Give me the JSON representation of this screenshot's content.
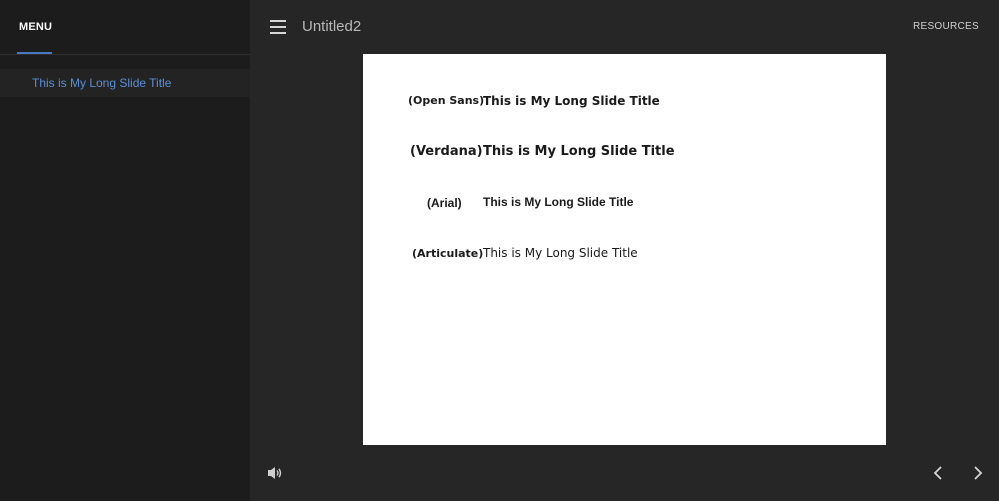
{
  "sidebar": {
    "tab_label": "MENU",
    "items": [
      {
        "label": "This is My Long Slide Title"
      }
    ]
  },
  "header": {
    "title": "Untitled2",
    "resources_label": "RESOURCES"
  },
  "slide": {
    "rows": [
      {
        "font_label": "(Open Sans)",
        "sample": "This is My Long Slide Title"
      },
      {
        "font_label": "(Verdana)",
        "sample": "This is My Long Slide Title"
      },
      {
        "font_label": "(Arial)",
        "sample": "This is My Long Slide Title"
      },
      {
        "font_label": "(Articulate)",
        "sample": "This is My Long Slide Title"
      }
    ]
  },
  "controls": {
    "volume_icon": "volume-icon",
    "prev_icon": "chevron-left-icon",
    "next_icon": "chevron-right-icon"
  },
  "colors": {
    "accent": "#4a78c0",
    "link": "#5a8fd6",
    "sidebar_bg": "#1c1c1c",
    "main_bg": "#262626"
  }
}
